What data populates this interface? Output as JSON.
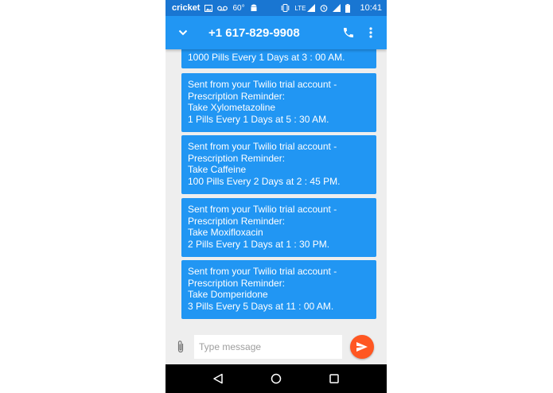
{
  "status_bar": {
    "carrier": "cricket",
    "temperature": "60°",
    "network": "LTE",
    "time": "10:41"
  },
  "app_bar": {
    "title": "+1 617-829-9908",
    "icons": [
      "chevron-down-icon",
      "phone-icon",
      "more-vert-icon"
    ]
  },
  "messages": [
    {
      "lines": [
        "1000 Pills Every 1 Days at 3 : 00 AM."
      ]
    },
    {
      "lines": [
        "Sent from your Twilio trial account -",
        "Prescription Reminder:",
        "Take Xylometazoline",
        "1 Pills Every 1 Days at 5 : 30 AM."
      ]
    },
    {
      "lines": [
        "Sent from your Twilio trial account -",
        "Prescription Reminder:",
        "Take Caffeine",
        "100 Pills Every 2 Days at 2 : 45 PM."
      ]
    },
    {
      "lines": [
        "Sent from your Twilio trial account -",
        "Prescription Reminder:",
        "Take Moxifloxacin",
        "2 Pills Every 1 Days at 1 : 30 PM."
      ]
    },
    {
      "lines": [
        "Sent from your Twilio trial account -",
        "Prescription Reminder:",
        "Take Domperidone",
        "3 Pills Every 5 Days at 11 : 00 AM."
      ]
    }
  ],
  "composer": {
    "placeholder": "Type message",
    "value": ""
  },
  "colors": {
    "status_bar": "#1976d2",
    "app_bar": "#2196f3",
    "bubble": "#2196f3",
    "send_button": "#ff5722",
    "background": "#eeeeee"
  }
}
